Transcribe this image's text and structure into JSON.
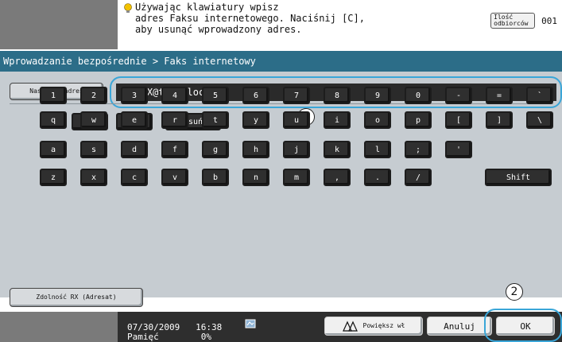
{
  "colors": {
    "titlebar": "#2c6d88",
    "panel": "#c6ccd1",
    "callout_ring": "#3aa6d8",
    "gray_block": "#7a7a7a",
    "status_bar": "#2e2e2e"
  },
  "message": {
    "icon": "lightbulb-icon",
    "lines": "Używając klawiatury wpisz\nadres Faksu internetowego. Naciśnij [C],\naby usunąć wprowadzony adres."
  },
  "recipients": {
    "label": "Ilość odbiorców",
    "count": "001"
  },
  "title": "Wprowadzanie bezpośrednie > Faks internetowy",
  "next_address_button": "Następny adres",
  "address_input": {
    "value": "I-FAX@test.local"
  },
  "callouts": [
    "1",
    "2"
  ],
  "keyboard": {
    "nav": [
      "←",
      "→",
      "Usuń"
    ],
    "row1": [
      "1",
      "2",
      "3",
      "4",
      "5",
      "6",
      "7",
      "8",
      "9",
      "0",
      "-",
      "=",
      "`"
    ],
    "row2": [
      "q",
      "w",
      "e",
      "r",
      "t",
      "y",
      "u",
      "i",
      "o",
      "p",
      "[",
      "]",
      "\\"
    ],
    "row3": [
      "a",
      "s",
      "d",
      "f",
      "g",
      "h",
      "j",
      "k",
      "l",
      ";",
      "'"
    ],
    "row4": [
      "z",
      "x",
      "c",
      "v",
      "b",
      "n",
      "m",
      ",",
      ".",
      "/"
    ],
    "shift": "Shift"
  },
  "rx_button": "Zdolność RX (Adresat)",
  "status": {
    "date": "07/30/2009",
    "time": "16:38",
    "memory_label": "Pamięć",
    "memory_value": "0%"
  },
  "buttons": {
    "magnify": "Powiększ wł",
    "cancel": "Anuluj",
    "ok": "OK"
  }
}
